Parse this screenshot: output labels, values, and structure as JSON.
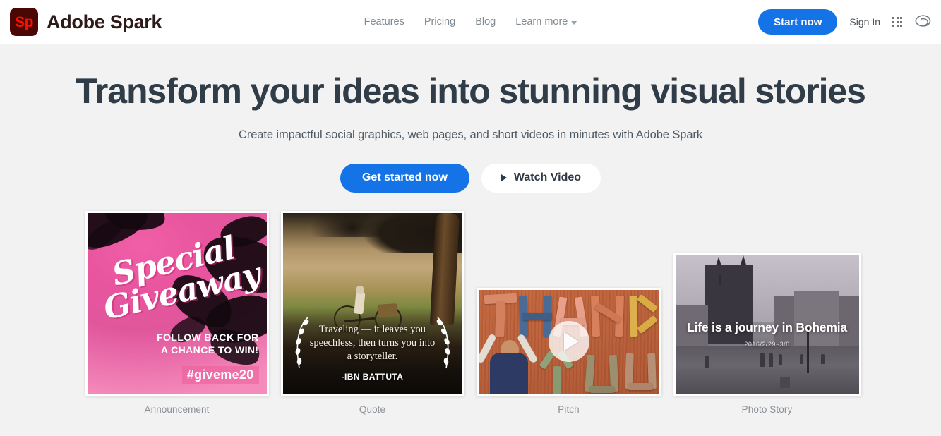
{
  "header": {
    "logo_text": "Sp",
    "logo_icon": "adobe-spark-logo-icon",
    "brand_name": "Adobe Spark",
    "nav": [
      {
        "label": "Features"
      },
      {
        "label": "Pricing"
      },
      {
        "label": "Blog"
      },
      {
        "label": "Learn more",
        "has_caret": true
      }
    ],
    "start_now_label": "Start now",
    "sign_in_label": "Sign In",
    "app_grid_icon": "app-grid-icon",
    "creative_cloud_icon": "creative-cloud-icon",
    "accent_color": "#1473e6",
    "logo_color": "#fa0f00"
  },
  "hero": {
    "headline": "Transform your ideas into stunning visual stories",
    "subhead": "Create impactful social graphics, web pages, and short videos in minutes with Adobe Spark",
    "primary_cta": "Get started now",
    "secondary_cta": "Watch Video",
    "play_icon": "play-triangle-icon"
  },
  "cards": [
    {
      "caption": "Announcement",
      "type": "graphic",
      "title_line1": "Special",
      "title_line2": "Giveaway",
      "body": "FOLLOW BACK FOR\nA CHANCE TO WIN!",
      "hashtag": "#giveme20"
    },
    {
      "caption": "Quote",
      "type": "graphic",
      "quote": "Traveling — it leaves you speechless, then turns you into a storyteller.",
      "author": "-IBN BATTUTA"
    },
    {
      "caption": "Pitch",
      "type": "video",
      "overlay_letters": "THANK YOU",
      "play_icon": "play-circle-icon"
    },
    {
      "caption": "Photo Story",
      "type": "photo",
      "title": "Life is a journey in Bohemia",
      "date": "2016/2/29~3/6"
    }
  ]
}
